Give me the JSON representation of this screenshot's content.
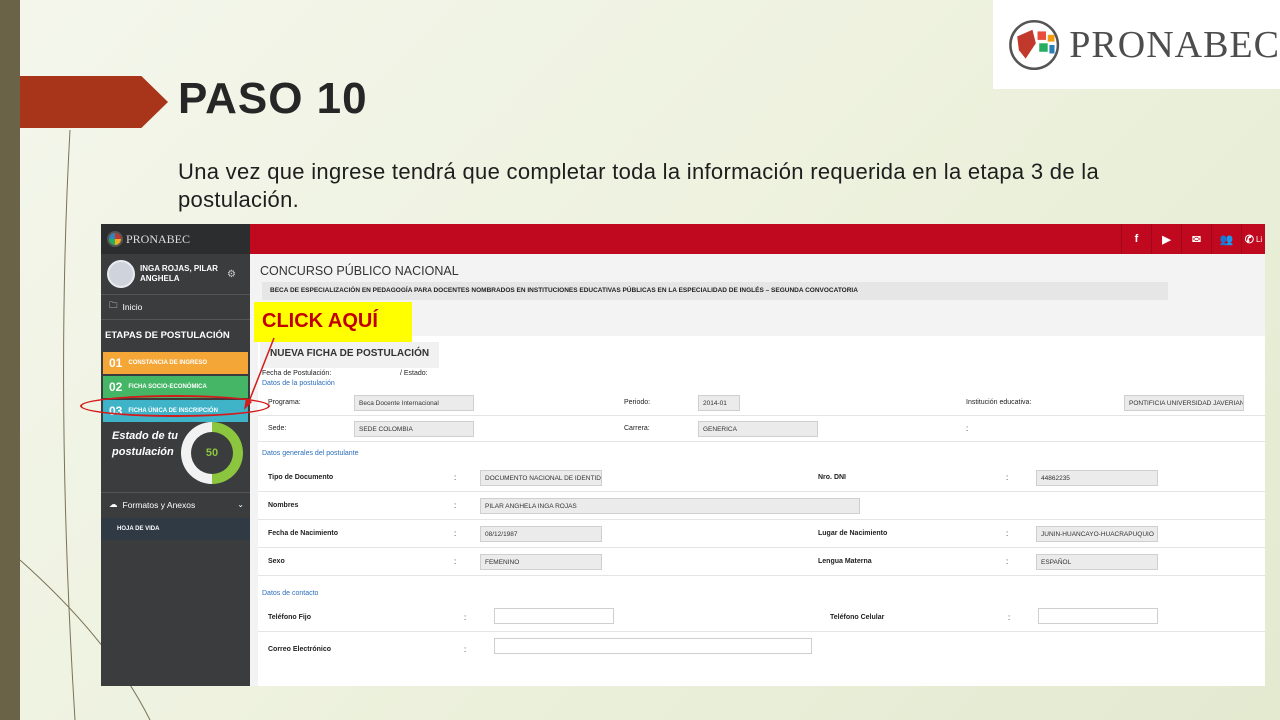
{
  "slide": {
    "title": "PASO 10",
    "text": "Una vez que ingrese tendrá que completar toda la información requerida en la etapa 3 de la postulación.",
    "logo_text": "PRONABEC",
    "callout": "CLICK AQUÍ"
  },
  "app": {
    "logo_text": "PRONABEC",
    "user_name": "INGA ROJAS, PILAR ANGHELA",
    "nav_inicio": "Inicio",
    "etapas_title": "ETAPAS DE POSTULACIÓN",
    "stages": [
      {
        "num": "01",
        "label": "CONSTANCIA DE INGRESO"
      },
      {
        "num": "02",
        "label": "FICHA SOCIO-ECONÓMICA"
      },
      {
        "num": "03",
        "label": "FICHA ÚNICA DE INSCRIPCIÓN"
      }
    ],
    "estado_text": "Estado de tu postulación",
    "progress_value": "50",
    "progress_fraction": 0.5,
    "formatos": "Formatos y Anexos",
    "hoja_de_vida": "HOJA DE VIDA",
    "topbar_partial": "Li"
  },
  "form": {
    "concurso": "CONCURSO PÚBLICO NACIONAL",
    "beca": "BECA DE ESPECIALIZACIÓN EN PEDAGOGÍA PARA DOCENTES NOMBRADOS EN INSTITUCIONES EDUCATIVAS PÚBLICAS EN LA ESPECIALIDAD DE INGLÉS – SEGUNDA CONVOCATORIA",
    "tab": "NUEVA FICHA DE POSTULACIÓN",
    "fecha_postulacion": "Fecha de Postulación:",
    "estado": "/ Estado:",
    "sec_postulacion": "Datos de la postulación",
    "programa_label": "Programa:",
    "programa_value": "Beca Docente Internacional",
    "periodo_label": "Periodo:",
    "periodo_value": "2014-01",
    "institucion_label": "Institución educativa:",
    "institucion_value": "PONTIFICIA UNIVERSIDAD JAVERIANA",
    "sede_label": "Sede:",
    "sede_value": "SEDE COLOMBIA",
    "carrera_label": "Carrera:",
    "carrera_value": "GENERICA",
    "sec_generales": "Datos generales del postulante",
    "tipo_doc_label": "Tipo de Documento",
    "tipo_doc_value": "DOCUMENTO NACIONAL DE IDENTIDAD",
    "dni_label": "Nro. DNI",
    "dni_value": "44862235",
    "nombres_label": "Nombres",
    "nombres_value": "PILAR ANGHELA INGA ROJAS",
    "nacimiento_label": "Fecha de Nacimiento",
    "nacimiento_value": "08/12/1987",
    "lugar_label": "Lugar de Nacimiento",
    "lugar_value": "JUNIN-HUANCAYO-HUACRAPUQUIO",
    "sexo_label": "Sexo",
    "sexo_value": "FEMENINO",
    "lengua_label": "Lengua Materna",
    "lengua_value": "ESPAÑOL",
    "sec_contacto": "Datos de contacto",
    "tel_fijo_label": "Teléfono Fijo",
    "tel_fijo_value": "",
    "tel_cel_label": "Teléfono Celular",
    "tel_cel_value": "",
    "correo_label": "Correo Electrónico",
    "correo_value": ""
  },
  "colors": {
    "topbar": "#c0091e",
    "sidebar": "#3b3c3e",
    "accent_arrow": "#a8341a",
    "callout_bg": "#ffff00",
    "callout_text": "#c00000"
  },
  "icons": [
    "facebook-icon",
    "youtube-icon",
    "mail-icon",
    "users-icon",
    "phone-icon",
    "folder-icon",
    "gear-icon",
    "cloud-icon",
    "chevron-down-icon"
  ]
}
